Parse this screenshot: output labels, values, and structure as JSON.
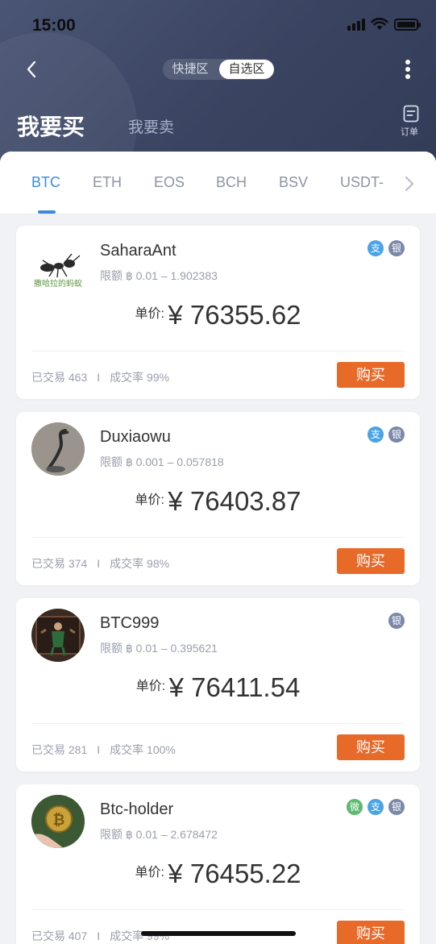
{
  "status_bar": {
    "time": "15:00"
  },
  "header": {
    "zones": [
      "快捷区",
      "自选区"
    ],
    "active_zone": "自选区",
    "side_buy": "我要买",
    "side_sell": "我要卖",
    "orders_label": "订单"
  },
  "coin_tabs": [
    "BTC",
    "ETH",
    "EOS",
    "BCH",
    "BSV",
    "USDT-"
  ],
  "active_coin": "BTC",
  "price_label": "单价:",
  "buy_label": "购买",
  "listings": [
    {
      "name": "SaharaAnt",
      "avatar_caption": "撒哈拉的蚂蚁",
      "limit": "限额 ฿ 0.01 – 1.902383",
      "price": "¥ 76355.62",
      "trades": "已交易 463",
      "rate": "成交率 99%",
      "payments": [
        "支",
        "银"
      ]
    },
    {
      "name": "Duxiaowu",
      "limit": "限额 ฿ 0.001 – 0.057818",
      "price": "¥ 76403.87",
      "trades": "已交易 374",
      "rate": "成交率 98%",
      "payments": [
        "支",
        "银"
      ]
    },
    {
      "name": "BTC999",
      "limit": "限额 ฿ 0.01 – 0.395621",
      "price": "¥ 76411.54",
      "trades": "已交易 281",
      "rate": "成交率 100%",
      "payments": [
        "银"
      ]
    },
    {
      "name": "Btc-holder",
      "limit": "限额 ฿ 0.01 – 2.678472",
      "price": "¥ 76455.22",
      "trades": "已交易 407",
      "rate": "成交率 99%",
      "payments": [
        "微",
        "支",
        "银"
      ]
    }
  ],
  "colors": {
    "header_bg": "#3a4461",
    "accent_blue": "#3a8be0",
    "buy_button": "#e76a29",
    "badge_alipay": "#4aa3e5",
    "badge_bank": "#7b88a8",
    "badge_wechat": "#5bba6f"
  }
}
